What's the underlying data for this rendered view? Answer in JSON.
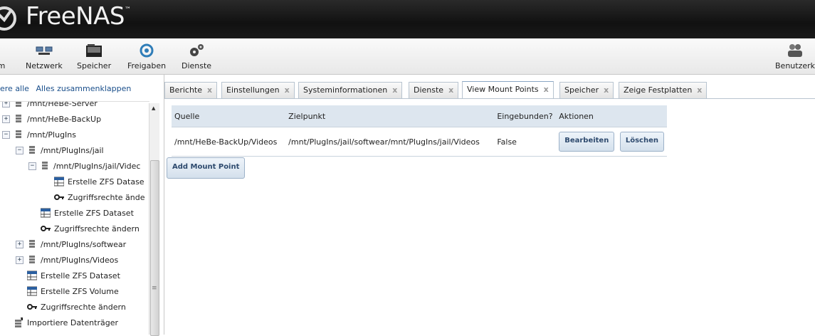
{
  "header": {
    "logo_text": "FreeNAS",
    "trademark": "™"
  },
  "toolbar": {
    "items": [
      {
        "label": "m"
      },
      {
        "label": "Netzwerk"
      },
      {
        "label": "Speicher"
      },
      {
        "label": "Freigaben"
      },
      {
        "label": "Dienste"
      },
      {
        "label": "Benutzerk"
      }
    ]
  },
  "left_panel": {
    "expand_all": "ere alle",
    "collapse_all": "Alles zusammenklappen",
    "tree": [
      {
        "label": "/mnt/HeBe-Server"
      },
      {
        "label": "/mnt/HeBe-BackUp"
      },
      {
        "label": "/mnt/PlugIns"
      },
      {
        "label": "/mnt/PlugIns/jail"
      },
      {
        "label": "/mnt/PlugIns/jail/Videc"
      },
      {
        "label": "Erstelle ZFS Datase"
      },
      {
        "label": "Zugriffsrechte ände"
      },
      {
        "label": "Erstelle ZFS Dataset"
      },
      {
        "label": "Zugriffsrechte ändern"
      },
      {
        "label": "/mnt/PlugIns/softwear"
      },
      {
        "label": "/mnt/PlugIns/Videos"
      },
      {
        "label": "Erstelle ZFS Dataset"
      },
      {
        "label": "Erstelle ZFS Volume"
      },
      {
        "label": "Zugriffsrechte ändern"
      },
      {
        "label": "Importiere Datenträger"
      }
    ]
  },
  "tabs": [
    {
      "label": "Berichte"
    },
    {
      "label": "Einstellungen"
    },
    {
      "label": "Systeminformationen"
    },
    {
      "label": "Dienste"
    },
    {
      "label": "View Mount Points"
    },
    {
      "label": "Speicher"
    },
    {
      "label": "Zeige Festplatten"
    }
  ],
  "mount_table": {
    "headers": [
      "Quelle",
      "Zielpunkt",
      "Eingebunden?",
      "Aktionen"
    ],
    "rows": [
      {
        "quelle": "/mnt/HeBe-BackUp/Videos",
        "zielpunkt": "/mnt/PlugIns/jail/softwear/mnt/PlugIns/jail/Videos",
        "eingebunden": "False",
        "edit_label": "Bearbeiten",
        "delete_label": "Löschen"
      }
    ]
  },
  "add_mount_point_label": "Add Mount Point"
}
